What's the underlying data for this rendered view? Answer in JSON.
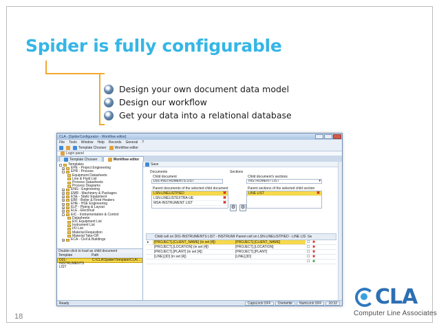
{
  "slide": {
    "title": "Spider is fully configurable",
    "bullets": [
      "Design your own document data model",
      "Design our workflow",
      "Get your data into a relational database"
    ],
    "page_number": "18",
    "logo_text": "CLA",
    "tagline": "Computer  Line  Associates"
  },
  "app": {
    "window_title": "CLA - [SpiderConfigurator - Workflow editor]",
    "menu": [
      "File",
      "Tools",
      "Window",
      "Help",
      "Records",
      "General",
      "?"
    ],
    "toolbar": [
      "Template Chooser",
      "Workflow editor"
    ],
    "login_label": "Login panel",
    "tabs": [
      "Template Chooser",
      "Workflow editor"
    ],
    "tree": [
      "Templates",
      "EPE - Project Engineering",
      "EPR - Process",
      "Equipment Datasheets",
      "Line & Fluid List",
      "Process Datasheets",
      "Process Diagrams",
      "ENG - Engineering",
      "EMR - Machinery & Packages",
      "ESE - Static Equipment",
      "EBF - Boiler & Fired Heaters",
      "EHE - HSE Engineering",
      "ELP - Piping & Layout",
      "ELE - Electrical",
      "EIC - Instrumentation & Control",
      "Datasheets",
      "EIC Equipment List",
      "Instrument List",
      "I/O List",
      "Material Requisition",
      "Material Take-Off",
      "ECA - Civil & Buildings"
    ],
    "double_click_hint": "Double-click to load as child document",
    "left_grid": {
      "headers": [
        "Template",
        "Path"
      ],
      "row": [
        "D01-INSTRUMENTS LIST",
        "C:\\CLA\\Spider\\Template\\CLA\\..."
      ]
    },
    "save_label": "Save",
    "documents_label": "Documents",
    "sections_label": "Sections",
    "child_document_label": "Child document",
    "child_document_value": "D01-INSTRUMENTS LIST",
    "child_sections_label": "Child document's sections",
    "child_sections_value": "INSTRUMENT LIST",
    "parent_docs_label": "Parent documents of the selected child document",
    "parent_docs": [
      "LSN-LINELISTPIED",
      "LSN-LINELISTEXTRA-UE",
      "MSA-INSTRUMENT LIST"
    ],
    "parent_sections_label": "Parent sections of the selected child section",
    "parent_sections": [
      "LINE LIST"
    ],
    "grid": {
      "headers": [
        "Child cell on D01-INSTRUMENTS LIST - INSTRUMENT LIST",
        "Parent cell on LSN-LINELISTPIED - LINE LIST",
        "Get only"
      ],
      "rows": [
        [
          "[PROJECT].[CLIENT_NAME] (in set [4])",
          "[PROJECT].[CLIENT_NAME]"
        ],
        [
          "[PROJECT].[LOCATION] (in set [4])",
          "[PROJECT].[LOCATION]"
        ],
        [
          "[PROJECT].[PLANT] (in set [4])",
          "[PROJECT].[PLANT]"
        ],
        [
          "[LINE].[ID] (in set [4])",
          "[LINE].[ID]"
        ]
      ]
    },
    "status": {
      "ready": "Ready",
      "caps": "CapsLock OFF",
      "overwrite": "Overwrite",
      "numlock": "NumLock OFF",
      "time": "10:32"
    }
  },
  "colors": {
    "title": "#35b6e6",
    "bracket": "#f0a830",
    "highlight": "#f6d94a",
    "logo": "#2d6fb3"
  }
}
